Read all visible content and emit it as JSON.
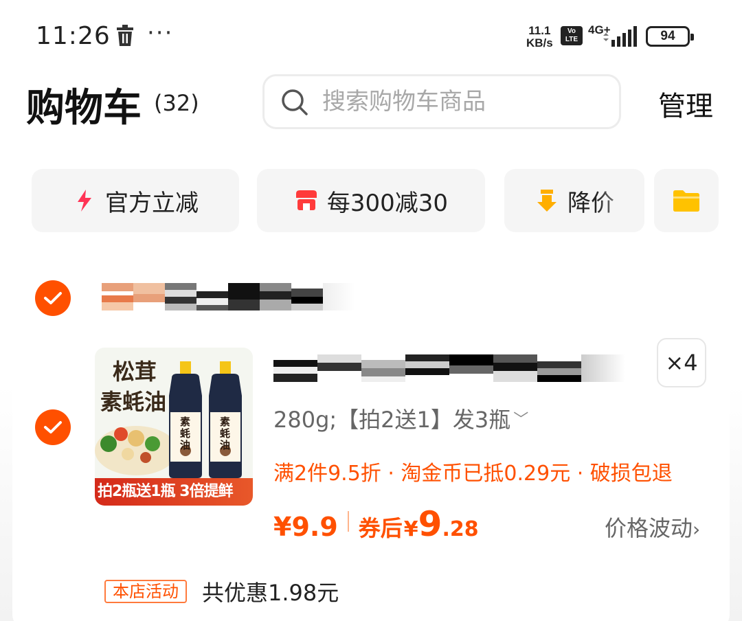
{
  "status_bar": {
    "time": "11:26",
    "net_speed_value": "11.1",
    "net_speed_unit": "KB/s",
    "volte_top": "Vo",
    "volte_bottom": "LTE",
    "network": "4G+",
    "battery": "94"
  },
  "header": {
    "title": "购物车",
    "count": "(32)",
    "search_placeholder": "搜索购物车商品",
    "manage_label": "管理"
  },
  "filters": [
    {
      "label": "官方立减",
      "icon": "lightning-icon"
    },
    {
      "label": "每300减30",
      "icon": "store-icon"
    },
    {
      "label": "降价",
      "icon": "price-down-icon"
    },
    {
      "label": "",
      "icon": "folder-icon"
    }
  ],
  "item": {
    "image_text_line1": "松茸",
    "image_text_line2": "素蚝油",
    "image_banner": "拍2瓶送1瓶 3倍提鲜",
    "bottle_label": "素蚝油",
    "quantity": "×4",
    "sku": "280g;【拍2送1】发3瓶",
    "promo": "满2件9.5折 · 淘金币已抵0.29元 · 破损包退",
    "price": "¥9.9",
    "coupon_label": "券后",
    "coupon_yuan": "¥",
    "coupon_int": "9",
    "coupon_dec": ".28",
    "price_trend": "价格波动"
  },
  "shop_activity": {
    "tag": "本店活动",
    "discount": "共优惠1.98元"
  },
  "colors": {
    "accent": "#ff5000",
    "chip_bg": "#f5f5f5"
  }
}
